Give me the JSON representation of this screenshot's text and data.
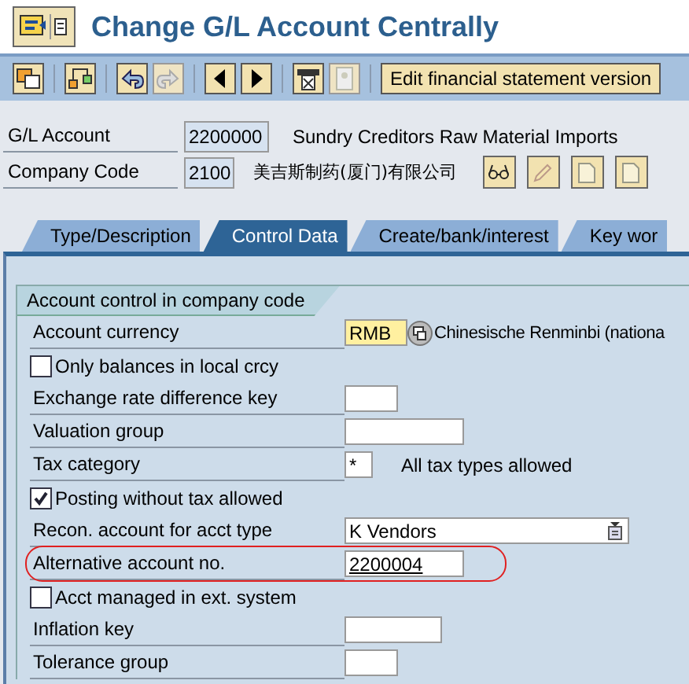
{
  "window": {
    "title": "Change G/L Account Centrally"
  },
  "toolbar": {
    "icon_buttons": [
      {
        "disabled": false
      },
      {
        "disabled": false
      },
      {
        "disabled": false
      },
      {
        "disabled": true
      },
      {
        "disabled": false
      },
      {
        "disabled": false
      },
      {
        "disabled": false
      },
      {
        "disabled": true
      }
    ],
    "text_button": "Edit financial statement version"
  },
  "header": {
    "fields": [
      {
        "label": "G/L Account",
        "value": "2200000",
        "description": "Sundry Creditors Raw Material Imports"
      },
      {
        "label": "Company Code",
        "value": "2100",
        "description": "美吉斯制药(厦门)有限公司"
      }
    ]
  },
  "tabs": [
    {
      "label": "Type/Description",
      "selected": false
    },
    {
      "label": "Control Data",
      "selected": true
    },
    {
      "label": "Create/bank/interest",
      "selected": false
    },
    {
      "label": "Key wor",
      "selected": false
    }
  ],
  "section": {
    "title": "Account control in company code",
    "rows": [
      {
        "kind": "field",
        "label": "Account currency",
        "value": "RMB",
        "required": true,
        "description": "Chinesische Renminbi (nationa",
        "highlighted": false
      },
      {
        "kind": "checkbox",
        "label": "Only balances in local crcy",
        "checked": false
      },
      {
        "kind": "field",
        "label": "Exchange rate difference key",
        "highlighted": false
      },
      {
        "kind": "field",
        "label": "Valuation group",
        "highlighted": false
      },
      {
        "kind": "field",
        "label": "Tax category",
        "value": "*",
        "description": "All tax types allowed",
        "highlighted": false
      },
      {
        "kind": "checkbox",
        "label": "Posting without tax allowed",
        "checked": true
      },
      {
        "kind": "field",
        "label": "Recon. account for acct type",
        "value": "K Vendors",
        "dropdown": true,
        "highlighted": false
      },
      {
        "kind": "field",
        "label": "Alternative account no.",
        "value": "2200004",
        "highlighted": true
      },
      {
        "kind": "checkbox",
        "label": "Acct managed in ext. system",
        "checked": false
      },
      {
        "kind": "field",
        "label": "Inflation key",
        "highlighted": false
      },
      {
        "kind": "field",
        "label": "Tolerance group",
        "highlighted": false
      }
    ]
  }
}
